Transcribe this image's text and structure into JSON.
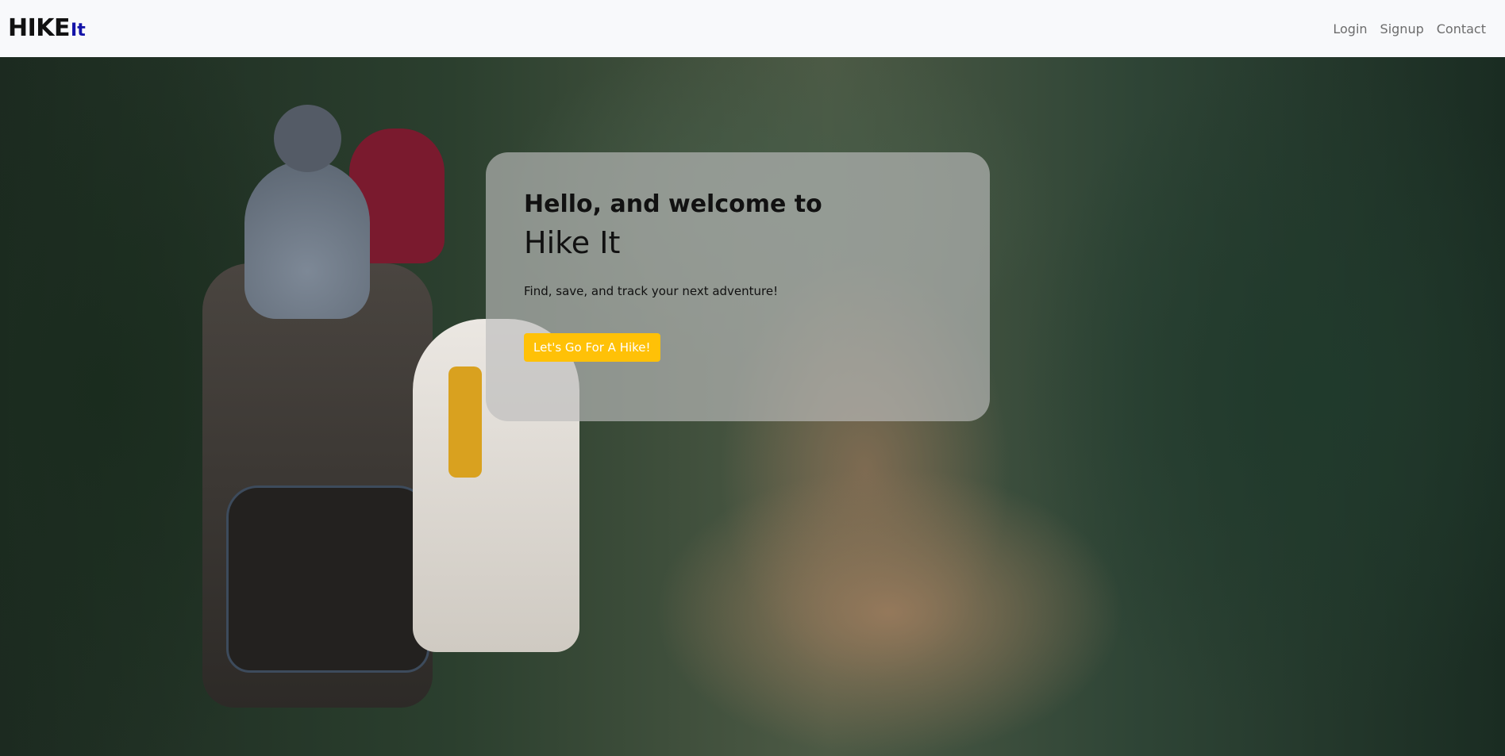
{
  "navbar": {
    "brand_main": "HIKE",
    "brand_accent": "It",
    "links": [
      "Login",
      "Signup",
      "Contact"
    ]
  },
  "hero": {
    "background_image": "forest trail with hiker carrying child in backpack carrier",
    "card": {
      "welcome_line": "Hello, and welcome to",
      "title": "Hike It",
      "tagline": "Find, save, and track your next adventure!",
      "cta_label": "Let's Go For A Hike!"
    }
  },
  "colors": {
    "navbar_bg": "#f8f9fb",
    "brand_accent": "#1313a8",
    "cta_bg": "#ffc107",
    "nav_link": "#6c6c6c"
  }
}
